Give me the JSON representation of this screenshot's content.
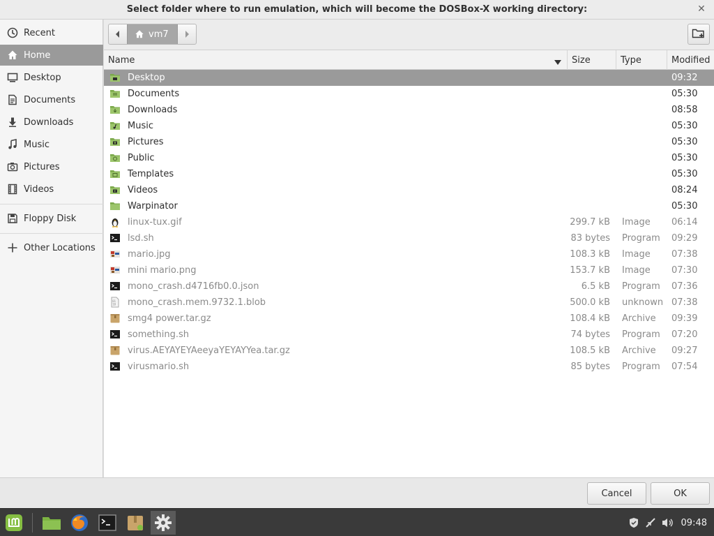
{
  "window": {
    "title": "Select folder where to run emulation, which will become the DOSBox-X working directory:",
    "close_icon": "close-icon"
  },
  "sidebar": {
    "items": [
      {
        "label": "Recent",
        "icon": "clock-icon"
      },
      {
        "label": "Home",
        "icon": "home-icon",
        "active": true
      },
      {
        "label": "Desktop",
        "icon": "desktop-icon"
      },
      {
        "label": "Documents",
        "icon": "document-icon"
      },
      {
        "label": "Downloads",
        "icon": "download-icon"
      },
      {
        "label": "Music",
        "icon": "music-icon"
      },
      {
        "label": "Pictures",
        "icon": "camera-icon"
      },
      {
        "label": "Videos",
        "icon": "film-icon"
      },
      {
        "label": "Floppy Disk",
        "icon": "floppy-icon"
      },
      {
        "label": "Other Locations",
        "icon": "plus-icon"
      }
    ]
  },
  "pathbar": {
    "current": "vm7",
    "back_icon": "chevron-left-icon",
    "forward_icon": "chevron-right-icon",
    "new_folder_icon": "new-folder-icon"
  },
  "columns": {
    "name": "Name",
    "size": "Size",
    "type": "Type",
    "modified": "Modified"
  },
  "files": [
    {
      "name": "Desktop",
      "size": "",
      "type": "",
      "modified": "09:32",
      "kind": "folder",
      "icon": "folder-desktop-icon"
    },
    {
      "name": "Documents",
      "size": "",
      "type": "",
      "modified": "05:30",
      "kind": "folder",
      "icon": "folder-documents-icon"
    },
    {
      "name": "Downloads",
      "size": "",
      "type": "",
      "modified": "08:58",
      "kind": "folder",
      "icon": "folder-downloads-icon"
    },
    {
      "name": "Music",
      "size": "",
      "type": "",
      "modified": "05:30",
      "kind": "folder",
      "icon": "folder-music-icon"
    },
    {
      "name": "Pictures",
      "size": "",
      "type": "",
      "modified": "05:30",
      "kind": "folder",
      "icon": "folder-pictures-icon"
    },
    {
      "name": "Public",
      "size": "",
      "type": "",
      "modified": "05:30",
      "kind": "folder",
      "icon": "folder-public-icon"
    },
    {
      "name": "Templates",
      "size": "",
      "type": "",
      "modified": "05:30",
      "kind": "folder",
      "icon": "folder-templates-icon"
    },
    {
      "name": "Videos",
      "size": "",
      "type": "",
      "modified": "08:24",
      "kind": "folder",
      "icon": "folder-videos-icon"
    },
    {
      "name": "Warpinator",
      "size": "",
      "type": "",
      "modified": "05:30",
      "kind": "folder",
      "icon": "folder-icon"
    },
    {
      "name": "linux-tux.gif",
      "size": "299.7 kB",
      "type": "Image",
      "modified": "06:14",
      "kind": "file",
      "icon": "tux-icon"
    },
    {
      "name": "lsd.sh",
      "size": "83 bytes",
      "type": "Program",
      "modified": "09:29",
      "kind": "file",
      "icon": "terminal-icon"
    },
    {
      "name": "mario.jpg",
      "size": "108.3 kB",
      "type": "Image",
      "modified": "07:38",
      "kind": "file",
      "icon": "image-icon"
    },
    {
      "name": "mini mario.png",
      "size": "153.7 kB",
      "type": "Image",
      "modified": "07:30",
      "kind": "file",
      "icon": "image-icon"
    },
    {
      "name": "mono_crash.d4716fb0.0.json",
      "size": "6.5 kB",
      "type": "Program",
      "modified": "07:36",
      "kind": "file",
      "icon": "terminal-icon"
    },
    {
      "name": "mono_crash.mem.9732.1.blob",
      "size": "500.0 kB",
      "type": "unknown",
      "modified": "07:38",
      "kind": "file",
      "icon": "binary-file-icon"
    },
    {
      "name": "smg4 power.tar.gz",
      "size": "108.4 kB",
      "type": "Archive",
      "modified": "09:39",
      "kind": "file",
      "icon": "archive-icon"
    },
    {
      "name": "something.sh",
      "size": "74 bytes",
      "type": "Program",
      "modified": "07:20",
      "kind": "file",
      "icon": "terminal-icon"
    },
    {
      "name": "virus.AEYAYEYAeeyaYEYAYYea.tar.gz",
      "size": "108.5 kB",
      "type": "Archive",
      "modified": "09:27",
      "kind": "file",
      "icon": "archive-icon"
    },
    {
      "name": "virusmario.sh",
      "size": "85 bytes",
      "type": "Program",
      "modified": "07:54",
      "kind": "file",
      "icon": "terminal-icon"
    }
  ],
  "selected_index": 0,
  "actions": {
    "cancel": "Cancel",
    "ok": "OK"
  },
  "taskbar": {
    "apps": [
      "mint-menu-icon",
      "files-icon",
      "firefox-icon",
      "terminal-icon",
      "archive-manager-icon",
      "settings-icon"
    ],
    "tray": [
      "shield-icon",
      "network-icon",
      "volume-icon"
    ],
    "clock": "09:48"
  },
  "colors": {
    "selection": "#9a9a9a",
    "folder_green": "#8cbb5a",
    "taskbar": "#3a3a3a"
  }
}
